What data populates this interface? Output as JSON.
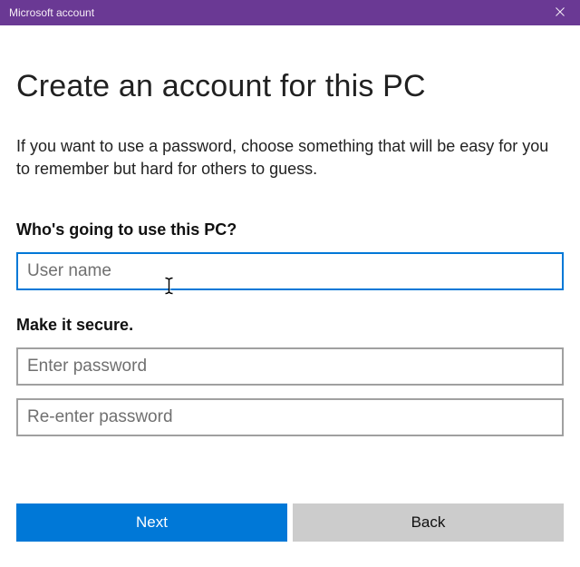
{
  "titlebar": {
    "title": "Microsoft account"
  },
  "page": {
    "title": "Create an account for this PC",
    "description": "If you want to use a password, choose something that will be easy for you to remember but hard for others to guess."
  },
  "sections": {
    "who": {
      "label": "Who's going to use this PC?",
      "username_placeholder": "User name"
    },
    "secure": {
      "label": "Make it secure.",
      "password_placeholder": "Enter password",
      "password_confirm_placeholder": "Re-enter password"
    }
  },
  "buttons": {
    "next": "Next",
    "back": "Back"
  }
}
